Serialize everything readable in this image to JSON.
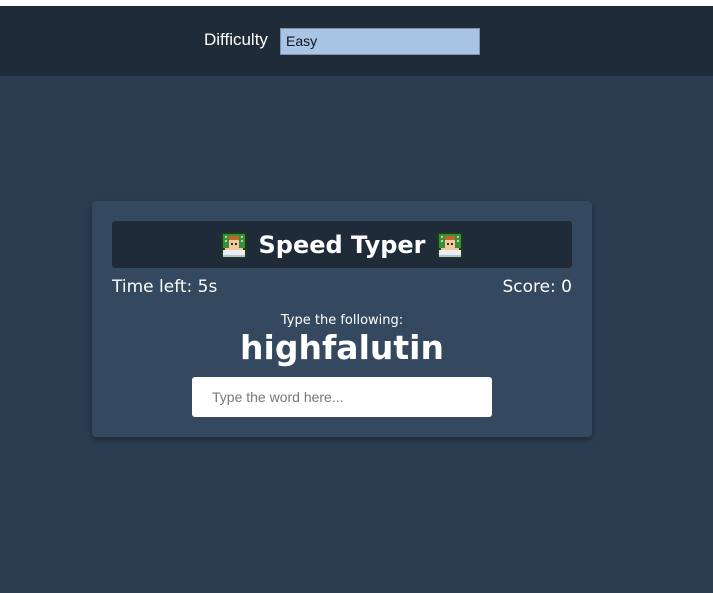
{
  "header": {
    "difficulty_label": "Difficulty",
    "difficulty_value": "Easy"
  },
  "game": {
    "title": "Speed Typer",
    "title_icon": "technologist-icon",
    "time_left_label": "Time left: 5s",
    "score_label": "Score: 0",
    "prompt": "Type the following:",
    "word": "highfalutin",
    "input_placeholder": "Type the word here..."
  },
  "colors": {
    "page_background": "#2c3d51",
    "header_background": "#202b3a",
    "card_background": "#34485f",
    "title_bar_background": "#202b3a",
    "select_background": "#a8c5e6",
    "text": "#ffffff"
  }
}
